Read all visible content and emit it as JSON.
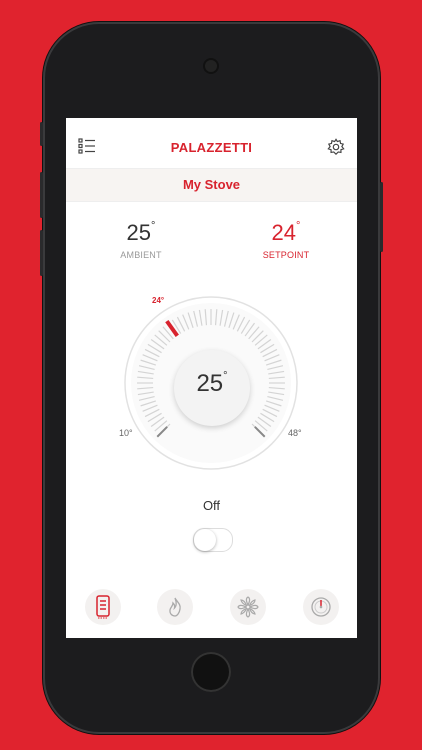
{
  "app": {
    "brand": "PALAZZETTI"
  },
  "header": {
    "title": "My Stove"
  },
  "temps": {
    "ambient_value": "25",
    "ambient_label": "AMBIENT",
    "setpoint_value": "24",
    "setpoint_label": "SETPOINT"
  },
  "dial": {
    "value": "25",
    "setpoint_marker": "24°",
    "min_label": "10°",
    "max_label": "48°",
    "min": 10,
    "max": 48,
    "setpoint": 24
  },
  "power": {
    "label": "Off",
    "on": false
  },
  "tabs": [
    {
      "icon": "thermometer-panel-icon",
      "active": true
    },
    {
      "icon": "flame-icon",
      "active": false
    },
    {
      "icon": "fan-icon",
      "active": false
    },
    {
      "icon": "gauge-icon",
      "active": false
    }
  ],
  "colors": {
    "accent": "#d8232e",
    "background": "#e0232e"
  }
}
